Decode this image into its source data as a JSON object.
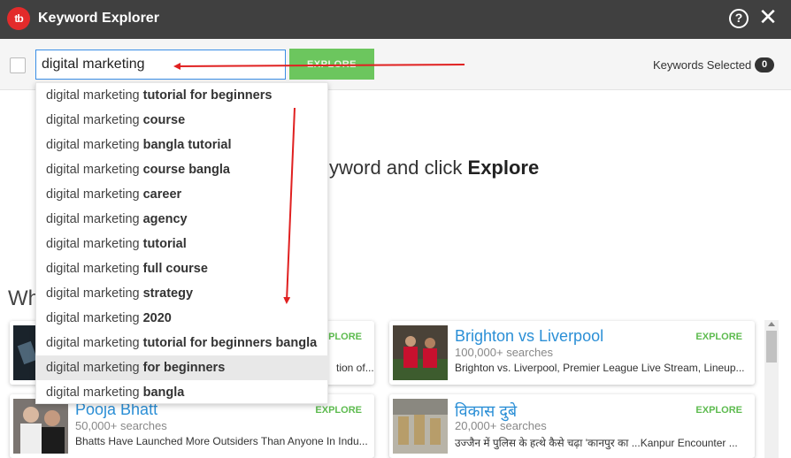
{
  "app": {
    "title": "Keyword Explorer",
    "logo_text": "tb",
    "help_icon": "question-circle-icon",
    "close_icon": "close-icon"
  },
  "toolbar": {
    "search_value": "digital marketing",
    "explore_label": "EXPLORE",
    "keywords_selected_label": "Keywords Selected",
    "keywords_selected_count": "0"
  },
  "hint": {
    "prefix": "yword and click ",
    "emphasis": "Explore"
  },
  "section_heading": "Wh",
  "suggestions": [
    {
      "base": "digital marketing ",
      "suffix": "tutorial for beginners"
    },
    {
      "base": "digital marketing ",
      "suffix": "course"
    },
    {
      "base": "digital marketing ",
      "suffix": "bangla tutorial"
    },
    {
      "base": "digital marketing ",
      "suffix": "course bangla"
    },
    {
      "base": "digital marketing ",
      "suffix": "career"
    },
    {
      "base": "digital marketing ",
      "suffix": "agency"
    },
    {
      "base": "digital marketing ",
      "suffix": "tutorial"
    },
    {
      "base": "digital marketing ",
      "suffix": "full course"
    },
    {
      "base": "digital marketing ",
      "suffix": "strategy"
    },
    {
      "base": "digital marketing ",
      "suffix": "2020"
    },
    {
      "base": "digital marketing ",
      "suffix": "tutorial for beginners bangla"
    },
    {
      "base": "digital marketing ",
      "suffix": "for beginners"
    },
    {
      "base": "digital marketing ",
      "suffix": "bangla"
    }
  ],
  "highlighted_suggestion_index": 11,
  "cards": [
    {
      "title": "",
      "searches": "",
      "desc": "tion of...",
      "explore": "EXPLORE"
    },
    {
      "title": "Brighton vs Liverpool",
      "searches": "100,000+ searches",
      "desc": "Brighton vs. Liverpool, Premier League Live Stream, Lineup...",
      "explore": "EXPLORE"
    },
    {
      "title": "Pooja Bhatt",
      "searches": "50,000+ searches",
      "desc": "Bhatts Have Launched More Outsiders Than Anyone In Indu...",
      "explore": "EXPLORE"
    },
    {
      "title": "विकास दुबे",
      "searches": "20,000+ searches",
      "desc": "उज्जैन में पुलिस के हत्थे कैसे चढ़ा 'कानपुर का ...Kanpur Encounter ...",
      "explore": "EXPLORE"
    }
  ],
  "colors": {
    "titlebar": "#404040",
    "logo_red": "#e32b2b",
    "explore_green": "#6cc65e",
    "link_blue": "#2b8fd6",
    "annotation_red": "#e02020"
  }
}
